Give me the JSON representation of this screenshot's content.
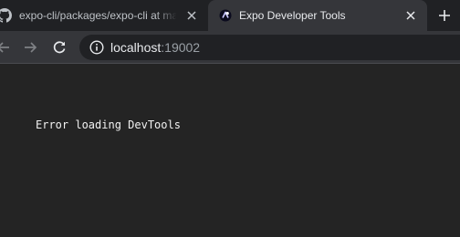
{
  "tabs": [
    {
      "title": "expo-cli/packages/expo-cli at master",
      "favicon": "github-icon",
      "active": false
    },
    {
      "title": "Expo Developer Tools",
      "favicon": "expo-icon",
      "active": true
    }
  ],
  "address_bar": {
    "host": "localhost",
    "port": ":19002"
  },
  "page": {
    "message": "Error loading DevTools"
  },
  "colors": {
    "tabstrip": "#202124",
    "toolbar": "#35363a",
    "omnibox": "#202124",
    "page_background": "#242424",
    "text": "#e8eaed",
    "muted_text": "#9aa0a6"
  }
}
